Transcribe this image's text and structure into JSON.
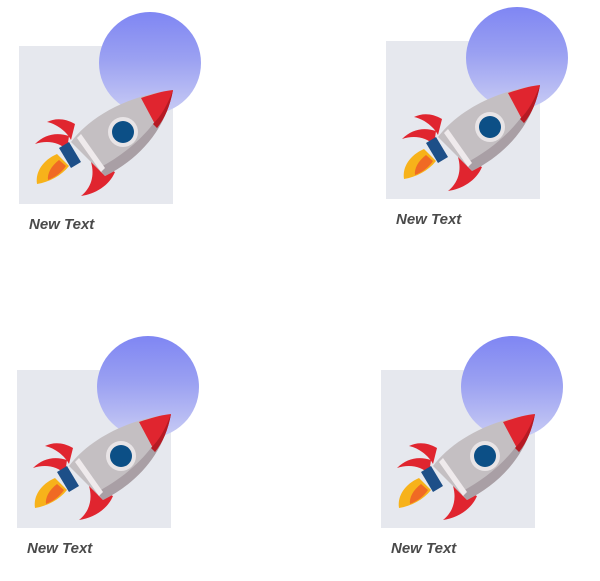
{
  "cards": [
    {
      "caption": "New Text",
      "icon": "rocket-icon"
    },
    {
      "caption": "New Text",
      "icon": "rocket-icon"
    },
    {
      "caption": "New Text",
      "icon": "rocket-icon"
    },
    {
      "caption": "New Text",
      "icon": "rocket-icon"
    }
  ],
  "colors": {
    "tile": "#e6e8ee",
    "planet_top": "#7f86f3",
    "planet_bottom": "#c9ccf4",
    "rocket_body": "#c4bfc2",
    "rocket_red": "#e0252f",
    "window": "#0c4f86",
    "flame": "#f7b21a",
    "caption_text": "#4a4a4a"
  }
}
